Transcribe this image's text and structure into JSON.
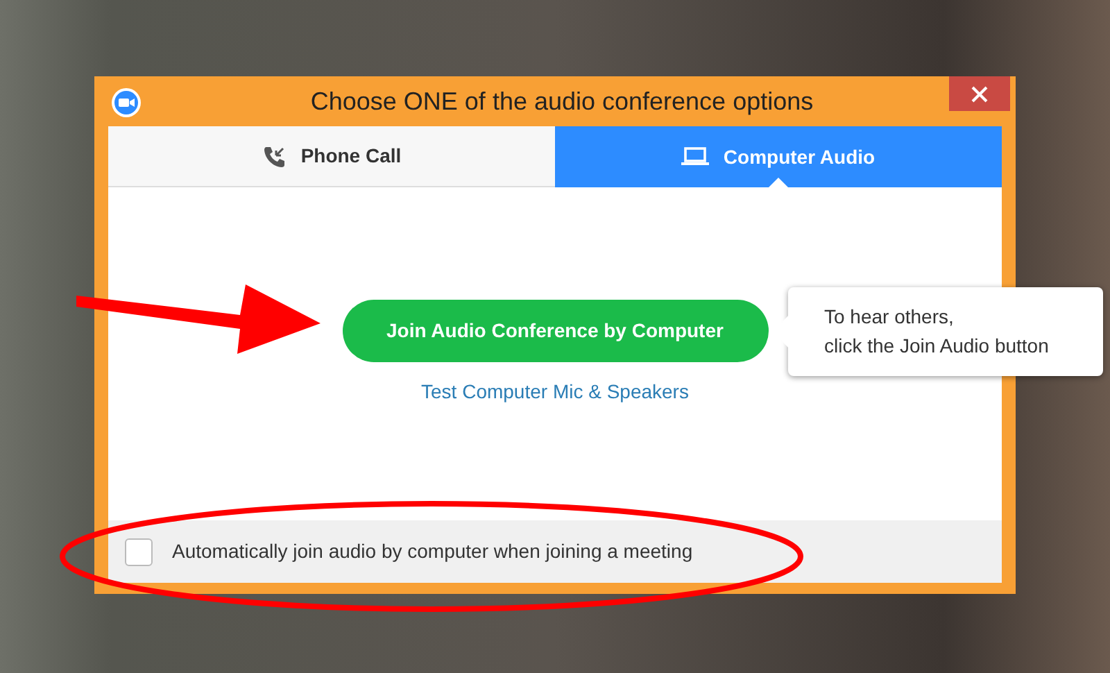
{
  "window": {
    "title": "Choose ONE of the audio conference options"
  },
  "tabs": [
    {
      "label": "Phone Call",
      "kind": "phone",
      "selected": false
    },
    {
      "label": "Computer Audio",
      "kind": "computer",
      "selected": true
    }
  ],
  "join_button": {
    "label": "Join Audio Conference by Computer"
  },
  "test_link": {
    "label": "Test Computer Mic & Speakers"
  },
  "tooltip": {
    "lines": [
      "To hear others,",
      "click the Join Audio button"
    ]
  },
  "auto_join": {
    "label": "Automatically join audio by computer when joining a meeting",
    "checked": false
  }
}
